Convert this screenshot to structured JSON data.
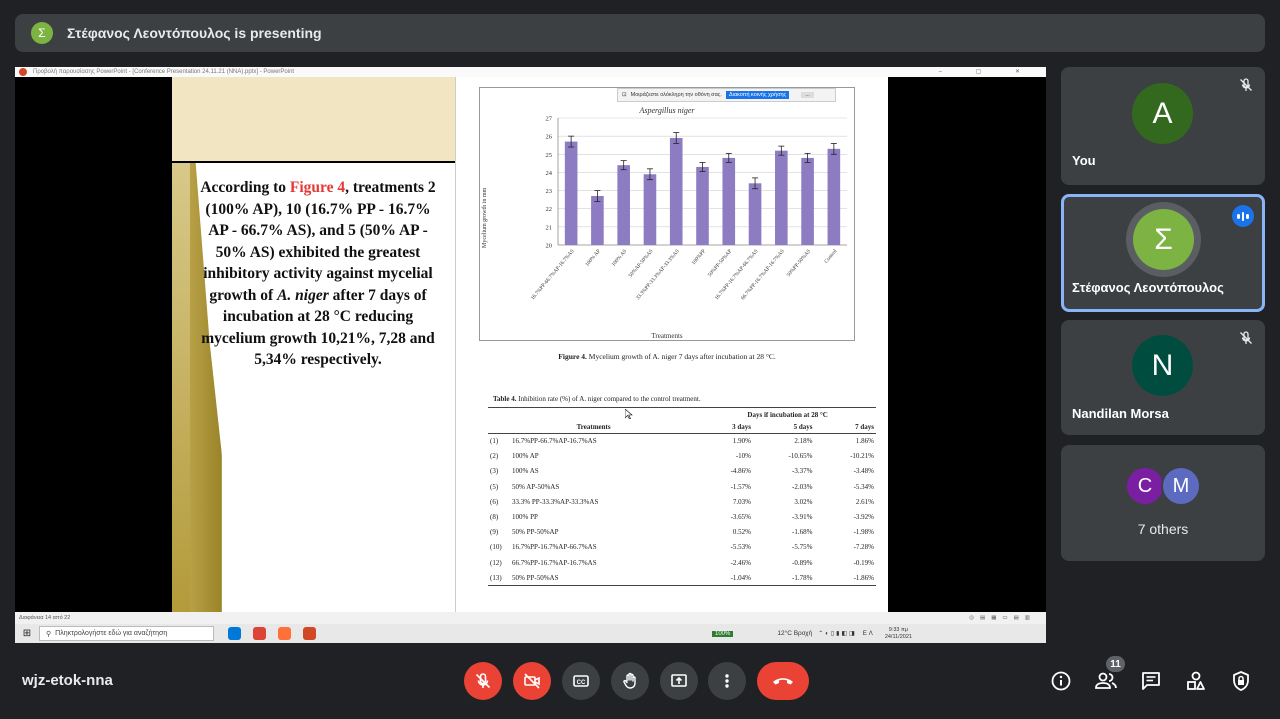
{
  "banner": {
    "avatar_letter": "Σ",
    "text": "Στέφανος Λεοντόπουλος is presenting"
  },
  "screen": {
    "window_title": "Προβολή παρουσίασης PowerPoint - [Conference Presentation 24.11.21 (NNA).pptx] - PowerPoint",
    "share_bar": {
      "message": "Μοιράζεστε ολόκληρη την οθόνη σας.",
      "stop_label": "Διακοπή κοινής χρήσης",
      "more_label": "..."
    },
    "slide": {
      "text_before": "According to ",
      "text_figure": "Figure 4",
      "text_after_1": ", treatments 2 (100% AP), 10 (16.7% PP - 16.7% AP - 66.7% AS), and 5 (50% AP - 50% AS) exhibited the greatest inhibitory activity against mycelial growth of ",
      "text_species": "A. niger",
      "text_after_2": " after 7 days of incubation at 28 °C reducing mycelium growth 10,21%, 7,28 and 5,34% respectively.",
      "figure_caption_bold": "Figure 4.",
      "figure_caption_text": " Mycelium growth of A. niger 7 days after incubation at 28 °C.",
      "table_caption_bold": "Table 4.",
      "table_caption_text": " Inhibition rate (%) of A. niger compared to the control treatment.",
      "table": {
        "group_header": "Days if incubation at 28 °C",
        "columns": [
          "Treatments",
          "3 days",
          "5 days",
          "7 days"
        ],
        "rows": [
          [
            "(1)",
            "16.7%PP-66.7%AP-16.7%AS",
            "1.90%",
            "2.18%",
            "1.86%"
          ],
          [
            "(2)",
            "100% AP",
            "-10%",
            "-10.65%",
            "-10.21%"
          ],
          [
            "(3)",
            "100% AS",
            "-4.86%",
            "-3.37%",
            "-3.48%"
          ],
          [
            "(5)",
            "50% AP-50%AS",
            "-1.57%",
            "-2.03%",
            "-5.34%"
          ],
          [
            "(6)",
            "33.3% PP-33.3%AP-33.3%AS",
            "7.03%",
            "3.02%",
            "2.61%"
          ],
          [
            "(8)",
            "100% PP",
            "-3.65%",
            "-3.91%",
            "-3.92%"
          ],
          [
            "(9)",
            "50% PP-50%AP",
            "0.52%",
            "-1.68%",
            "-1.98%"
          ],
          [
            "(10)",
            "16.7%PP-16.7%AP-66.7%AS",
            "-5.53%",
            "-5.75%",
            "-7.28%"
          ],
          [
            "(12)",
            "66.7%PP-16.7%AP-16.7%AS",
            "-2.46%",
            "-0.89%",
            "-0.19%"
          ],
          [
            "(13)",
            "50% PP-50%AS",
            "-1.04%",
            "-1.78%",
            "-1.86%"
          ]
        ]
      }
    },
    "ppt_status": "Διαφάνεια 14 από 22",
    "taskbar": {
      "search_placeholder": "Πληκτρολογήστε εδώ για αναζήτηση",
      "battery": "100%",
      "weather": "12°C Βροχή",
      "lang": "ΕΛ",
      "time": "9:33 πμ",
      "date": "24/11/2021"
    }
  },
  "chart_data": {
    "type": "bar",
    "title": "Aspergillus niger",
    "xlabel": "Treatments",
    "ylabel": "Mycelium growth in mm",
    "ylim": [
      20,
      27
    ],
    "yticks": [
      20,
      21,
      22,
      23,
      24,
      25,
      26,
      27
    ],
    "color": "#8e7cc3",
    "categories": [
      "16.7%PP-66.7%AP-16.7%AS",
      "100% AP",
      "100% AS",
      "50%AP-50%AS",
      "33.3%PP-33.3%AP-33.3%AS",
      "100%PP",
      "50%PP-50%AP",
      "16.7%PP-16.7%AP-66.7%AS",
      "66.7%PP-16.7%AP-16.7%AS",
      "50%PP-50%AS",
      "Control"
    ],
    "values": [
      25.7,
      22.7,
      24.4,
      23.9,
      25.9,
      24.3,
      24.8,
      23.4,
      25.2,
      24.8,
      25.3
    ],
    "errors": [
      0.3,
      0.3,
      0.25,
      0.3,
      0.3,
      0.25,
      0.25,
      0.3,
      0.25,
      0.25,
      0.3
    ]
  },
  "participants": [
    {
      "name": "You",
      "letter": "A",
      "color": "#33691e",
      "muted": true
    },
    {
      "name": "Στέφανος Λεοντόπουλος",
      "letter": "Σ",
      "color": "#7cb342",
      "speaking": true
    },
    {
      "name": "Nandilan Morsa",
      "letter": "N",
      "color": "#004d40",
      "muted": true
    }
  ],
  "others": {
    "letters": [
      "C",
      "M"
    ],
    "colors": [
      "#7b1fa2",
      "#5c6bc0"
    ],
    "label": "7 others"
  },
  "bottom": {
    "meeting_code": "wjz-etok-nna",
    "people_count": "11"
  }
}
